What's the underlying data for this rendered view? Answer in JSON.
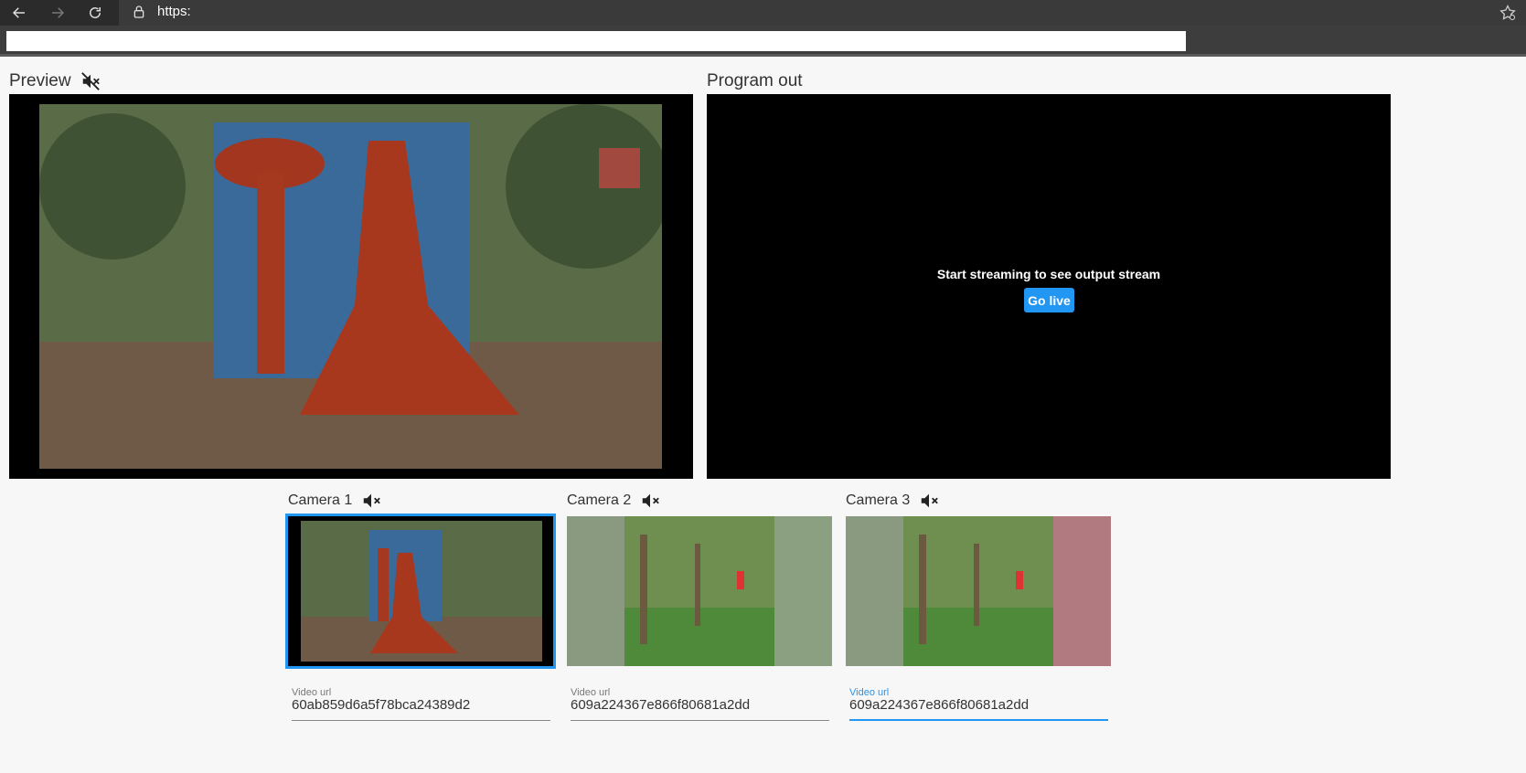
{
  "browser": {
    "url": "https:"
  },
  "preview": {
    "title": "Preview"
  },
  "program": {
    "title": "Program out",
    "message": "Start streaming to see output stream",
    "go_live_label": "Go live"
  },
  "cameras": [
    {
      "title": "Camera 1",
      "url_label": "Video url",
      "url_value": "60ab859d6a5f78bca24389d2"
    },
    {
      "title": "Camera 2",
      "url_label": "Video url",
      "url_value": "609a224367e866f80681a2dd"
    },
    {
      "title": "Camera 3",
      "url_label": "Video url",
      "url_value": "609a224367e866f80681a2dd"
    }
  ],
  "colors": {
    "accent": "#2196f3"
  },
  "icons": {
    "mute": "volume-off-icon",
    "back": "arrow-left-icon",
    "forward": "arrow-right-icon",
    "refresh": "refresh-icon",
    "lock": "lock-icon",
    "favorites": "star-settings-icon"
  }
}
